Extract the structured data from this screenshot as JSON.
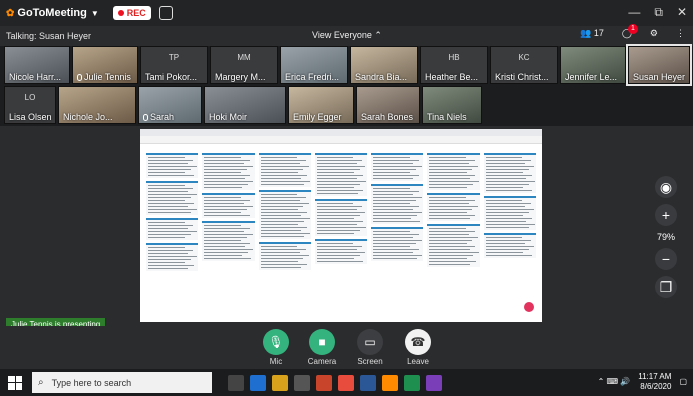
{
  "app": {
    "brand": "GoToMeeting",
    "rec_label": "REC"
  },
  "window_controls": [
    "—",
    "⧉",
    "✕"
  ],
  "infobar": {
    "talking": "Talking: Susan Heyer",
    "view": "View Everyone",
    "participant_count": "17",
    "notifications": "1"
  },
  "participants": [
    {
      "name": "Nicole Harr...",
      "initials": ""
    },
    {
      "name": "Julie Tennis",
      "initials": ""
    },
    {
      "name": "Tami Pokor...",
      "initials": "TP"
    },
    {
      "name": "Margery M...",
      "initials": "MM"
    },
    {
      "name": "Erica Fredri...",
      "initials": ""
    },
    {
      "name": "Sandra Bia...",
      "initials": ""
    },
    {
      "name": "Heather Be...",
      "initials": "HB"
    },
    {
      "name": "Kristi Christ...",
      "initials": "KC"
    },
    {
      "name": "Jennifer Le...",
      "initials": ""
    },
    {
      "name": "Susan Heyer",
      "initials": ""
    },
    {
      "name": "Lisa Olsen",
      "initials": "LO"
    },
    {
      "name": "Nichole Jo...",
      "initials": ""
    },
    {
      "name": "Sarah",
      "initials": ""
    },
    {
      "name": "Hoki Moir",
      "initials": ""
    },
    {
      "name": "Emily Egger",
      "initials": ""
    },
    {
      "name": "Sarah Bones",
      "initials": ""
    },
    {
      "name": "Tina Niels",
      "initials": ""
    }
  ],
  "zoom": {
    "percent": "79%"
  },
  "presenting": "Julie Tennis is presenting",
  "controls": {
    "mic": "Mic",
    "camera": "Camera",
    "screen": "Screen",
    "leave": "Leave"
  },
  "taskbar": {
    "search_placeholder": "Type here to search",
    "time": "11:17 AM",
    "date": "8/6/2020"
  },
  "colors": {
    "accent_green": "#35b37e",
    "rec_red": "#e12222",
    "brand_orange": "#ff8a00"
  }
}
